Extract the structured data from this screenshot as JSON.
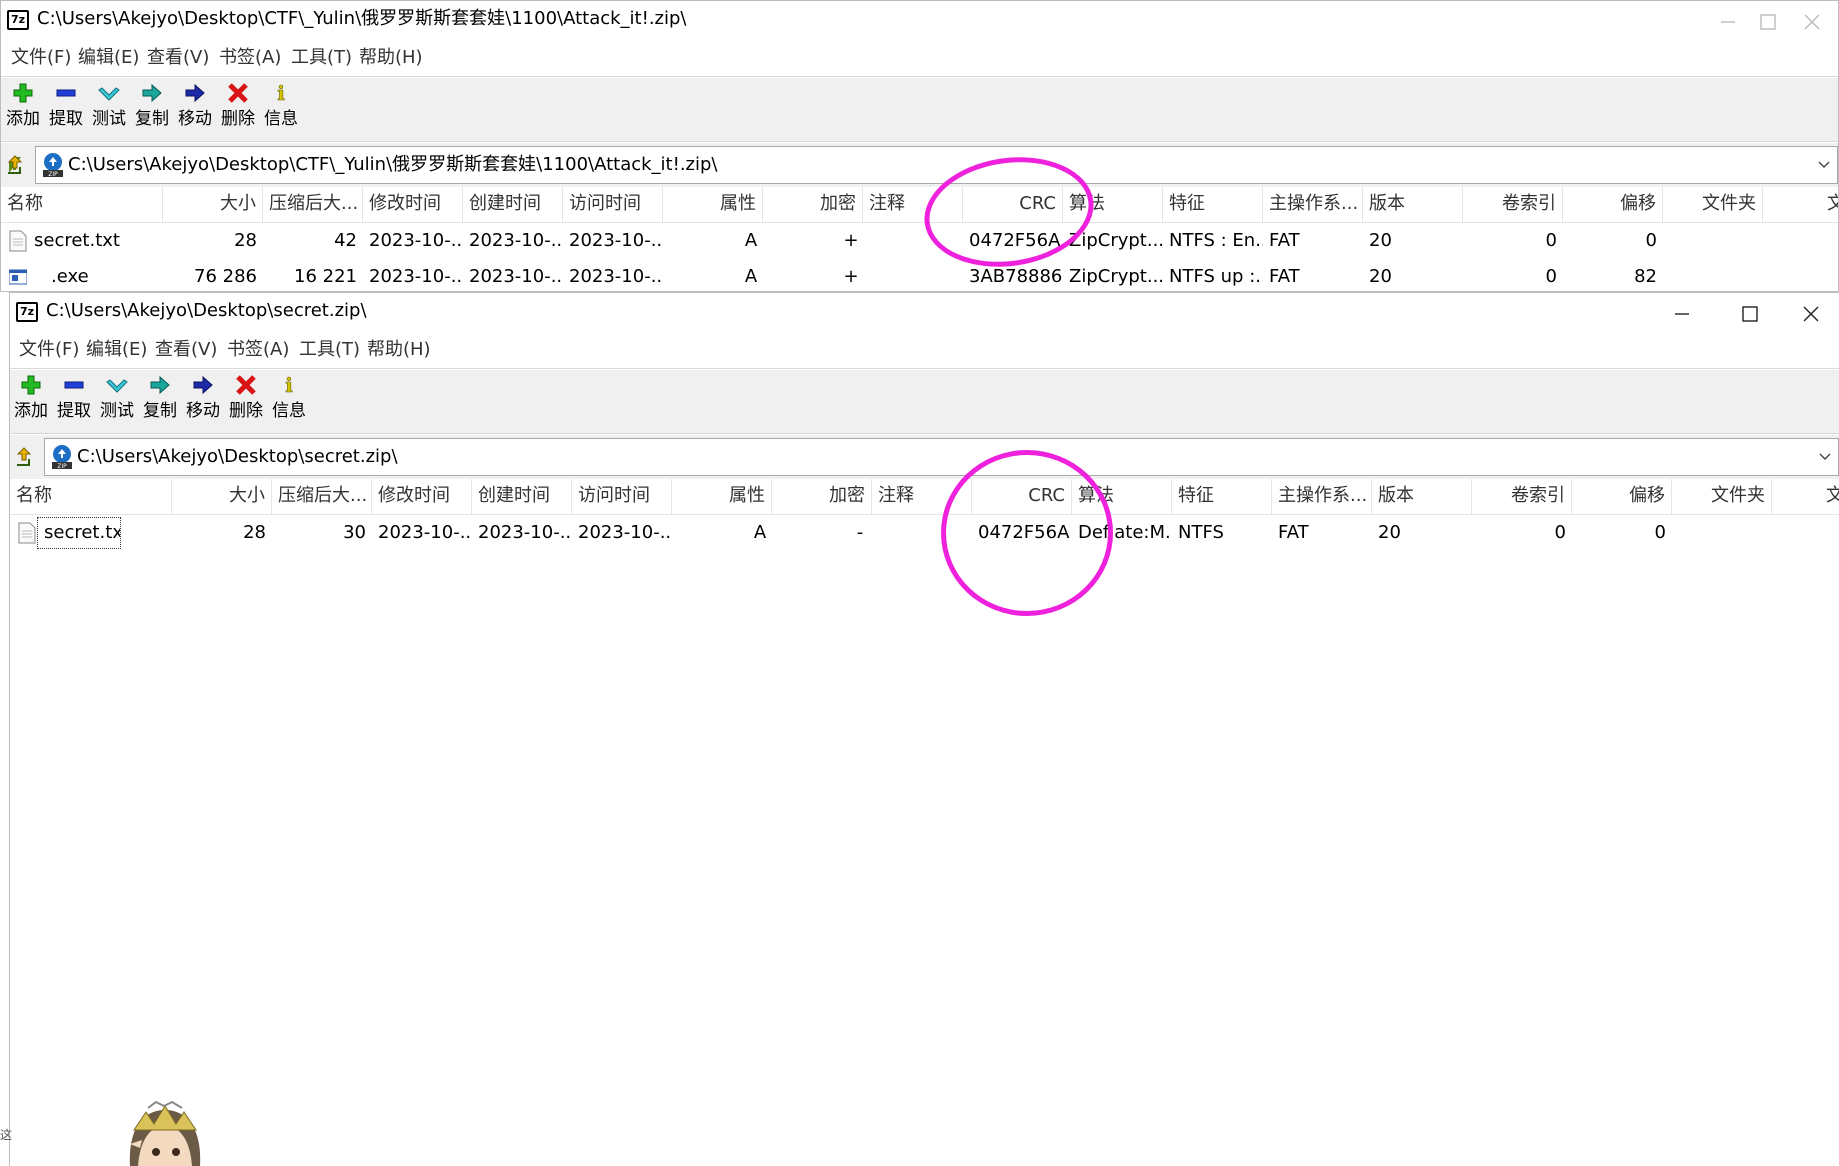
{
  "window1": {
    "title": "C:\\Users\\Akejyo\\Desktop\\CTF\\_Yulin\\俄罗罗斯斯套套娃\\1100\\Attack_it!.zip\\",
    "menu": [
      "文件(F)",
      "编辑(E)",
      "查看(V)",
      "书签(A)",
      "工具(T)",
      "帮助(H)"
    ],
    "toolbar": [
      "添加",
      "提取",
      "测试",
      "复制",
      "移动",
      "删除",
      "信息"
    ],
    "address": "C:\\Users\\Akejyo\\Desktop\\CTF\\_Yulin\\俄罗罗斯斯套套娃\\1100\\Attack_it!.zip\\",
    "columns": [
      "名称",
      "大小",
      "压缩后大...",
      "修改时间",
      "创建时间",
      "访问时间",
      "属性",
      "加密",
      "注释",
      "CRC",
      "算法",
      "特征",
      "主操作系...",
      "版本",
      "卷索引",
      "偏移",
      "文件夹",
      "文"
    ],
    "rows": [
      {
        "name": "secret.txt",
        "size": "28",
        "packed": "42",
        "modified": "2023-10-...",
        "created": "2023-10-...",
        "accessed": "2023-10-...",
        "attr": "A",
        "encrypted": "+",
        "comment": "",
        "crc": "0472F56A",
        "method": "ZipCrypt...",
        "characteristics": "NTFS : En...",
        "host_os": "FAT",
        "version": "20",
        "volume": "0",
        "offset": "0",
        "folder": ""
      },
      {
        "name": ".exe",
        "size": "76 286",
        "packed": "16 221",
        "modified": "2023-10-...",
        "created": "2023-10-...",
        "accessed": "2023-10-...",
        "attr": "A",
        "encrypted": "+",
        "comment": "",
        "crc": "3AB78886",
        "method": "ZipCrypt...",
        "characteristics": "NTFS up :...",
        "host_os": "FAT",
        "version": "20",
        "volume": "0",
        "offset": "82",
        "folder": ""
      }
    ]
  },
  "window2": {
    "title": "C:\\Users\\Akejyo\\Desktop\\secret.zip\\",
    "menu": [
      "文件(F)",
      "编辑(E)",
      "查看(V)",
      "书签(A)",
      "工具(T)",
      "帮助(H)"
    ],
    "toolbar": [
      "添加",
      "提取",
      "测试",
      "复制",
      "移动",
      "删除",
      "信息"
    ],
    "address": "C:\\Users\\Akejyo\\Desktop\\secret.zip\\",
    "columns": [
      "名称",
      "大小",
      "压缩后大...",
      "修改时间",
      "创建时间",
      "访问时间",
      "属性",
      "加密",
      "注释",
      "CRC",
      "算法",
      "特征",
      "主操作系...",
      "版本",
      "卷索引",
      "偏移",
      "文件夹",
      "文"
    ],
    "rows": [
      {
        "name": "secret.txt",
        "size": "28",
        "packed": "30",
        "modified": "2023-10-...",
        "created": "2023-10-...",
        "accessed": "2023-10-...",
        "attr": "A",
        "encrypted": "-",
        "comment": "",
        "crc": "0472F56A",
        "method": "Deflate:M...",
        "characteristics": "NTFS",
        "host_os": "FAT",
        "version": "20",
        "volume": "0",
        "offset": "0",
        "folder": ""
      }
    ]
  },
  "app_icon_text": "7z",
  "annotation_color": "#ee22dd",
  "edge_char": "这"
}
